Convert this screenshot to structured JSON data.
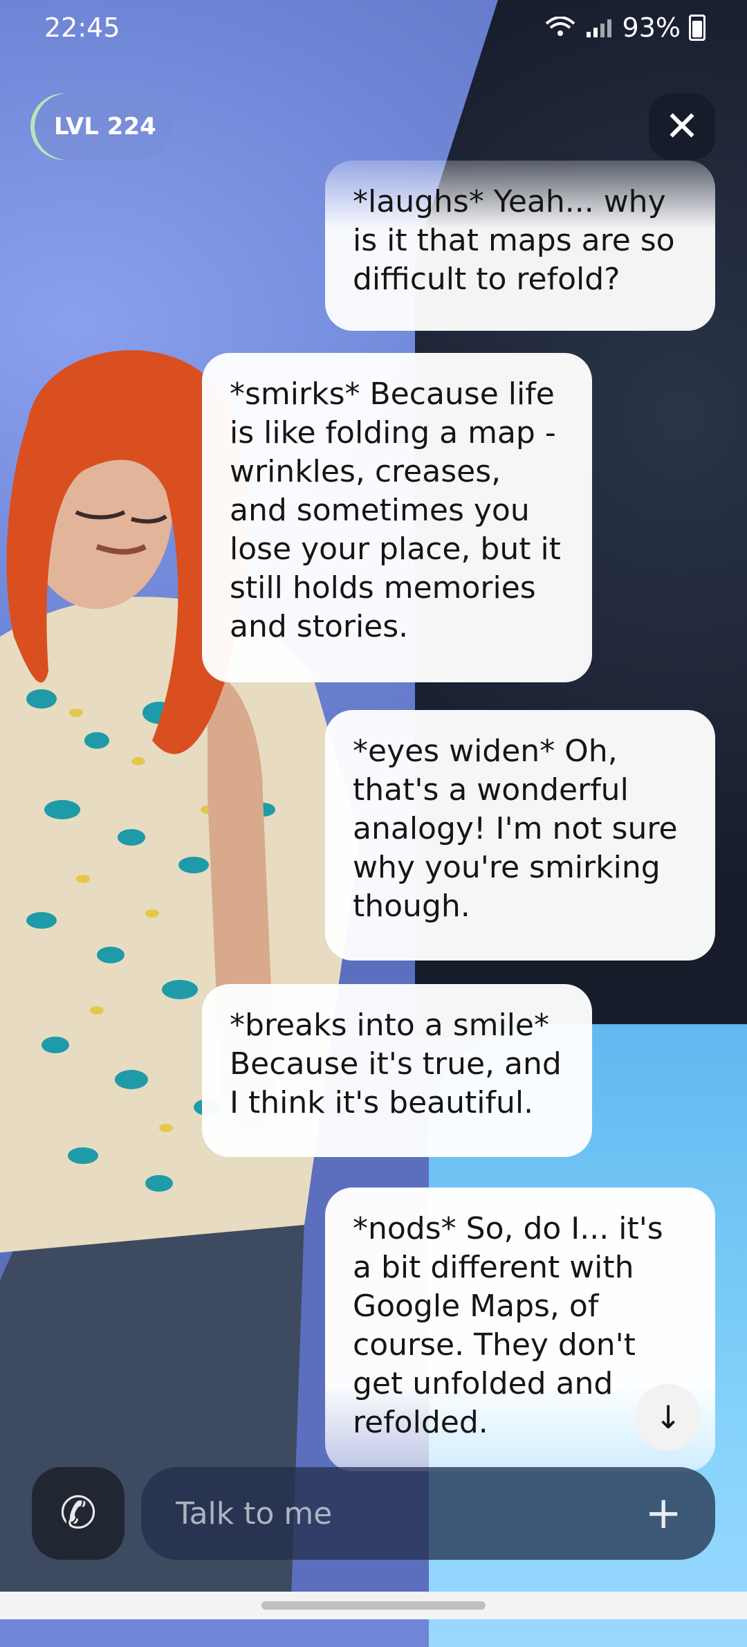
{
  "status": {
    "time": "22:45",
    "battery": "93%"
  },
  "header": {
    "level_label": "LVL 224"
  },
  "messages": [
    {
      "text": "*laughs* Yeah... why is it that maps are so difficult to refold?"
    },
    {
      "text": "*smirks* Because life is like folding a map - wrinkles, creases, and sometimes you lose your place, but it still holds memories and stories."
    },
    {
      "text": "*eyes widen* Oh, that's a wonderful analogy! I'm not sure why you're smirking though."
    },
    {
      "text": "*breaks into a smile* Because it's true, and I think it's beautiful."
    },
    {
      "text": "*nods* So, do I... it's a bit different with Google Maps, of course. They don't get unfolded and refolded."
    }
  ],
  "input": {
    "placeholder": "Talk to me"
  },
  "icons": {
    "close": "close-icon",
    "scroll_down": "arrow-down-icon",
    "call": "phone-icon",
    "add": "plus-icon"
  }
}
